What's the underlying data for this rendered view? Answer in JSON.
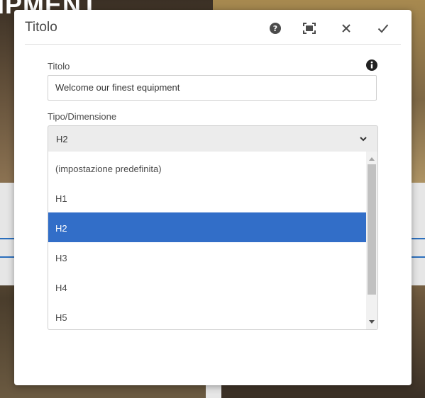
{
  "background": {
    "headline": "IPMENT"
  },
  "dialog": {
    "title": "Titolo",
    "buttons": {
      "help": "help-icon",
      "fullscreen": "fullscreen-icon",
      "close": "close-icon",
      "done": "check-icon"
    },
    "title_field": {
      "label": "Titolo",
      "value": "Welcome our finest equipment"
    },
    "type_field": {
      "label": "Tipo/Dimensione",
      "selected": "H2",
      "options": [
        "(impostazione predefinita)",
        "H1",
        "H2",
        "H3",
        "H4",
        "H5"
      ]
    }
  },
  "colors": {
    "accent": "#326ec8",
    "select_background": "#ececec",
    "text": "#4b4b4b"
  }
}
